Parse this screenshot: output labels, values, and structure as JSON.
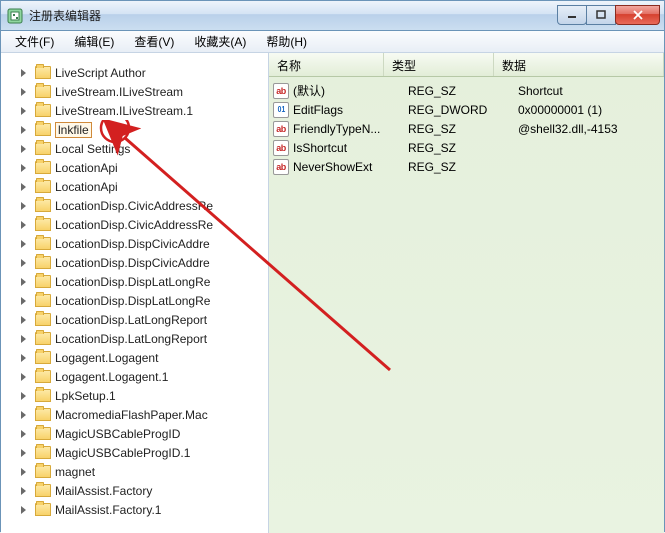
{
  "window": {
    "title": "注册表编辑器"
  },
  "menu": {
    "file": "文件(F)",
    "edit": "编辑(E)",
    "view": "查看(V)",
    "fav": "收藏夹(A)",
    "help": "帮助(H)"
  },
  "tree": {
    "items": [
      "LiveScript Author",
      "LiveStream.ILiveStream",
      "LiveStream.ILiveStream.1",
      "lnkfile",
      "Local Settings",
      "LocationApi",
      "LocationApi",
      "LocationDisp.CivicAddressRe",
      "LocationDisp.CivicAddressRe",
      "LocationDisp.DispCivicAddre",
      "LocationDisp.DispCivicAddre",
      "LocationDisp.DispLatLongRe",
      "LocationDisp.DispLatLongRe",
      "LocationDisp.LatLongReport",
      "LocationDisp.LatLongReport",
      "Logagent.Logagent",
      "Logagent.Logagent.1",
      "LpkSetup.1",
      "MacromediaFlashPaper.Mac",
      "MagicUSBCableProgID",
      "MagicUSBCableProgID.1",
      "magnet",
      "MailAssist.Factory",
      "MailAssist.Factory.1"
    ],
    "selected_index": 3
  },
  "list": {
    "columns": {
      "name": "名称",
      "type": "类型",
      "data": "数据"
    },
    "rows": [
      {
        "icon": "sz",
        "name": "(默认)",
        "type": "REG_SZ",
        "data": "Shortcut"
      },
      {
        "icon": "dw",
        "name": "EditFlags",
        "type": "REG_DWORD",
        "data": "0x00000001 (1)"
      },
      {
        "icon": "sz",
        "name": "FriendlyTypeN...",
        "type": "REG_SZ",
        "data": "@shell32.dll,-4153"
      },
      {
        "icon": "sz",
        "name": "IsShortcut",
        "type": "REG_SZ",
        "data": ""
      },
      {
        "icon": "sz",
        "name": "NeverShowExt",
        "type": "REG_SZ",
        "data": ""
      }
    ]
  }
}
